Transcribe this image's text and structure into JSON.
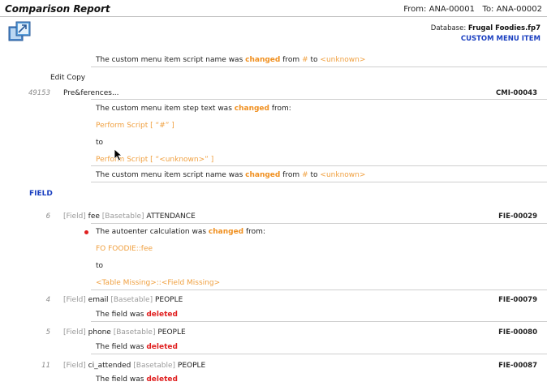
{
  "header": {
    "title": "Comparison Report",
    "from_label": "From:",
    "from_value": "ANA-00001",
    "to_label": "To:",
    "to_value": "ANA-00002",
    "database_label": "Database:",
    "database_value": "Frugal Foodies.fp7",
    "section": "CUSTOM MENU ITEM"
  },
  "menu": {
    "row0": {
      "prefix": "The custom menu item script name was",
      "changed": "changed",
      "from": "from",
      "old": "#",
      "to": "to",
      "new": "<unknown>"
    },
    "edit_copy": "Edit Copy",
    "item": {
      "number": "49153",
      "name": "Pre&ferences...",
      "id": "CMI-00043",
      "step_prefix": "The custom menu item step text was",
      "changed": "changed",
      "step_suffix": "from:",
      "old_value": "Perform Script [ “#” ]",
      "to": "to",
      "new_value": "Perform Script [ “<unknown>” ]",
      "name_prefix": "The custom menu item script name was",
      "name_changed": "changed",
      "name_from": "from",
      "name_old": "#",
      "name_to": "to",
      "name_new": "<unknown>"
    }
  },
  "field_section": {
    "title": "FIELD"
  },
  "fields": [
    {
      "number": "6",
      "tag": "[Field]",
      "name": "fee",
      "bt_tag": "[Basetable]",
      "table": "ATTENDANCE",
      "id": "FIE-00029",
      "change_prefix": "The autoenter calculation was",
      "change_word": "changed",
      "change_suffix": "from:",
      "old_value": "FO FOODIE::fee",
      "to": "to",
      "new_value": "<Table Missing>::<Field Missing>"
    },
    {
      "number": "4",
      "tag": "[Field]",
      "name": "email",
      "bt_tag": "[Basetable]",
      "table": "PEOPLE",
      "id": "FIE-00079",
      "msg": "The field was",
      "status": "deleted"
    },
    {
      "number": "5",
      "tag": "[Field]",
      "name": "phone",
      "bt_tag": "[Basetable]",
      "table": "PEOPLE",
      "id": "FIE-00080",
      "msg": "The field was",
      "status": "deleted"
    },
    {
      "number": "11",
      "tag": "[Field]",
      "name": "ci_attended",
      "bt_tag": "[Basetable]",
      "table": "PEOPLE",
      "id": "FIE-00087",
      "msg": "The field was",
      "status": "deleted"
    }
  ],
  "colors": {
    "changed": "#f09020",
    "deleted": "#e02020",
    "link_blue": "#1a3fc0",
    "value_orange": "#f0a040"
  },
  "icons": {
    "app": "database-compare-icon",
    "cursor": "mouse-pointer-icon",
    "bullet": "red-bullet-icon"
  }
}
